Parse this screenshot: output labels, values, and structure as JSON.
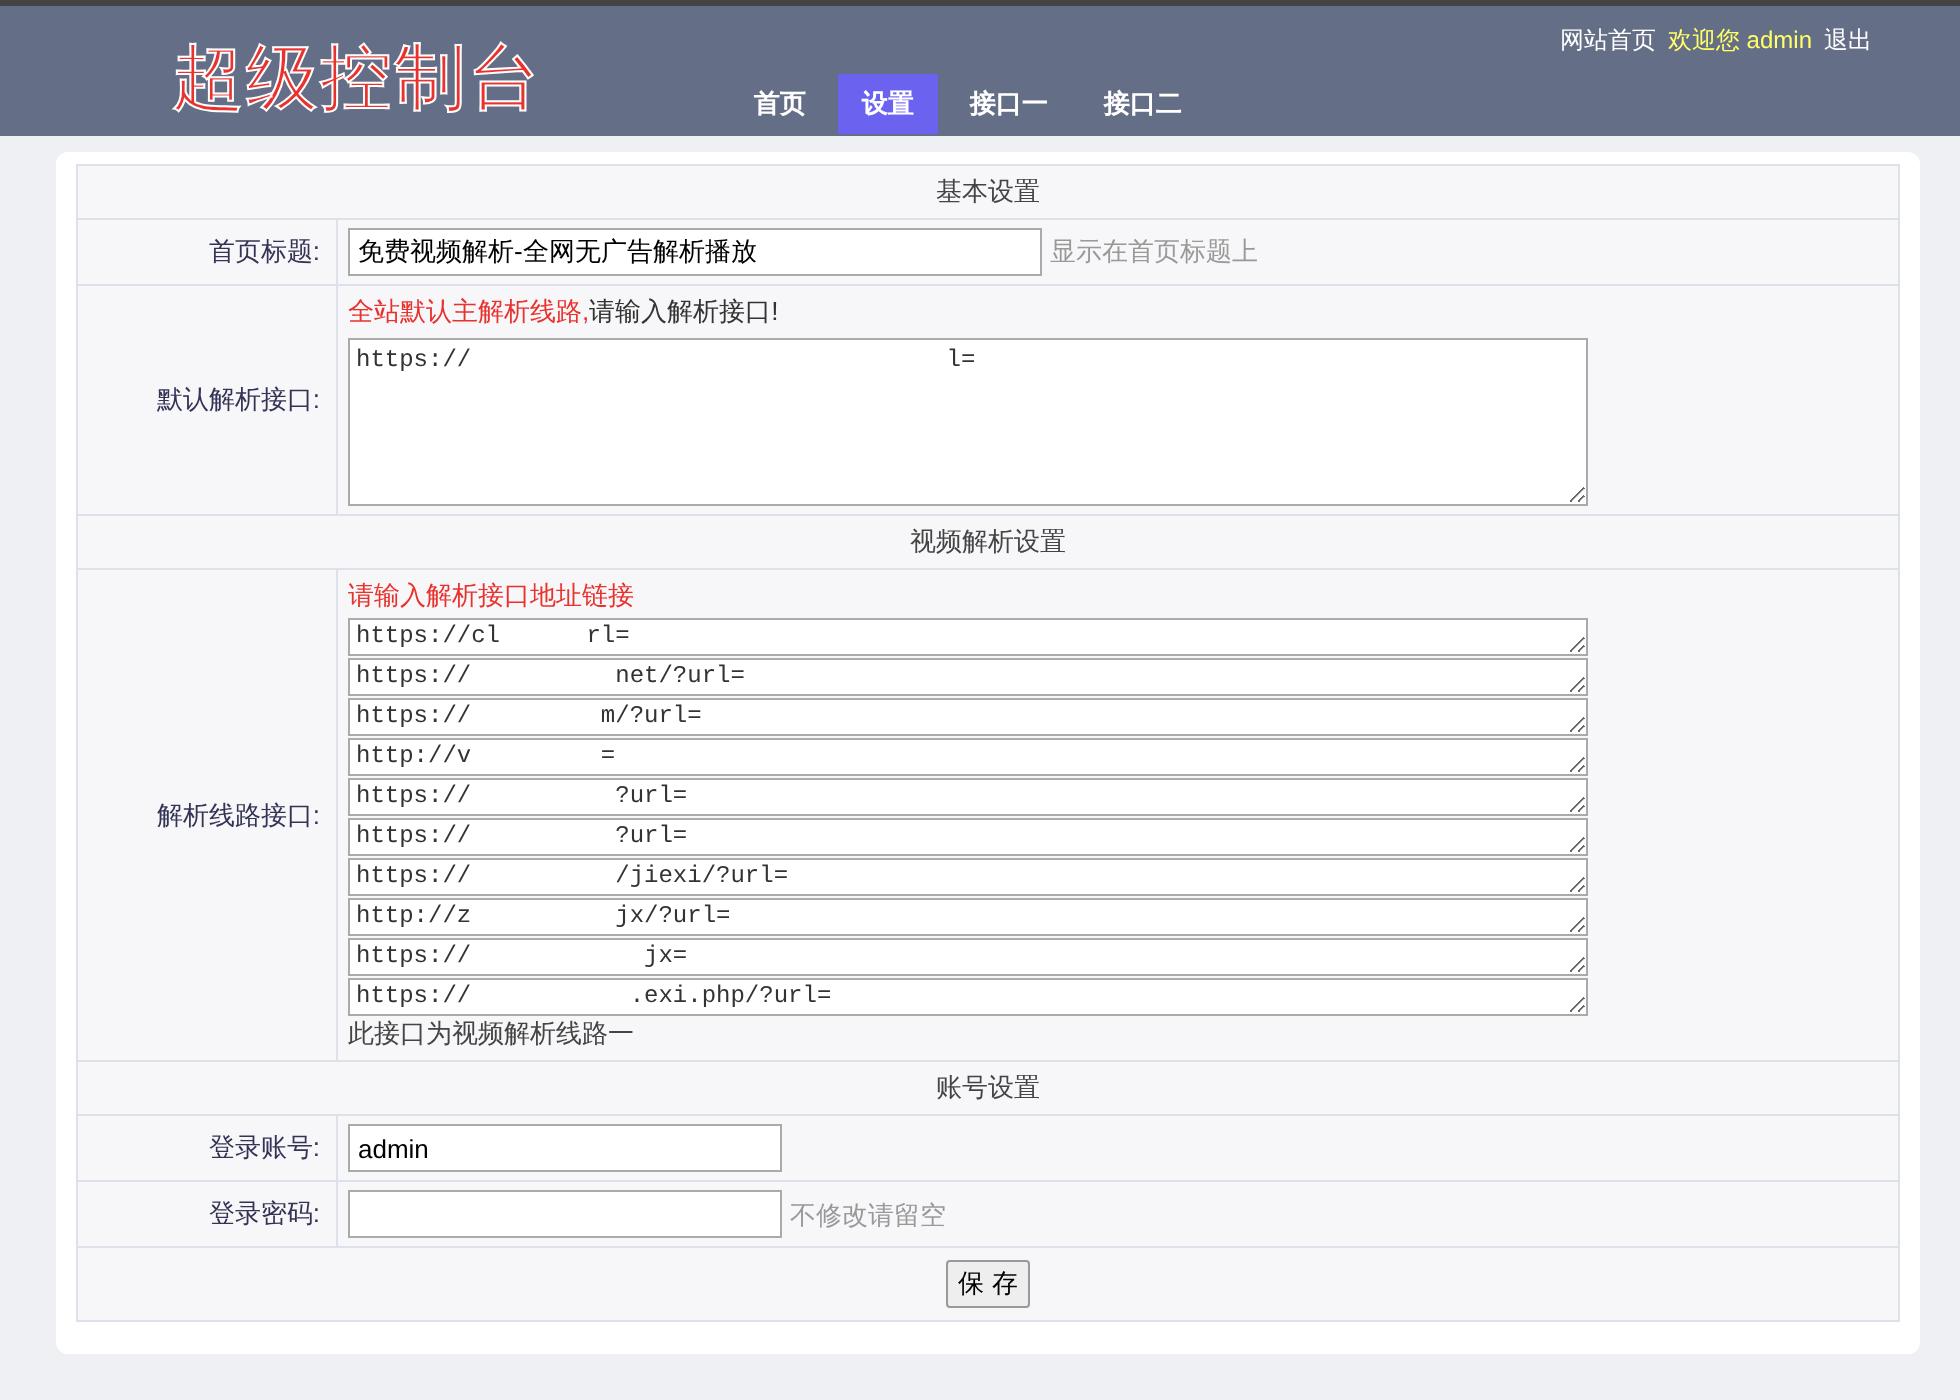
{
  "header": {
    "logo": "超级控制台",
    "nav": [
      {
        "label": "首页",
        "selected": false
      },
      {
        "label": "设置",
        "selected": true
      },
      {
        "label": "接口一",
        "selected": false
      },
      {
        "label": "接口二",
        "selected": false
      }
    ],
    "links": [
      {
        "label": "网站首页",
        "kind": "link"
      },
      {
        "label": "欢迎您 admin",
        "kind": "welcome"
      },
      {
        "label": "退出",
        "kind": "link"
      }
    ]
  },
  "sections": [
    {
      "title": "基本设置",
      "rows": [
        {
          "kind": "input",
          "label": "首页标题:",
          "value": "免费视频解析-全网无广告解析播放",
          "hint": "显示在首页标题上"
        },
        {
          "kind": "textarea",
          "label": "默认解析接口:",
          "note_red": "全站默认主解析线路,",
          "note": "请输入解析接口!",
          "value": "https://                                 l="
        }
      ]
    },
    {
      "title": "视频解析设置",
      "rows": [
        {
          "kind": "lines",
          "label": "解析线路接口:",
          "note_red": "请输入解析接口地址链接",
          "lines": [
            "https://cl      rl=",
            "https://          net/?url=",
            "https://         m/?url=",
            "http://v         =",
            "https://          ?url=",
            "https://          ?url=",
            "https://          /jiexi/?url=",
            "http://z          jx/?url=",
            "https://            jx=",
            "https://           .exi.php/?url="
          ],
          "footer": "此接口为视频解析线路一"
        }
      ]
    },
    {
      "title": "账号设置",
      "rows": [
        {
          "kind": "input",
          "label": "登录账号:",
          "value": "admin"
        },
        {
          "kind": "password",
          "label": "登录密码:",
          "hint": "不修改请留空"
        }
      ]
    }
  ],
  "save_button": "保 存"
}
